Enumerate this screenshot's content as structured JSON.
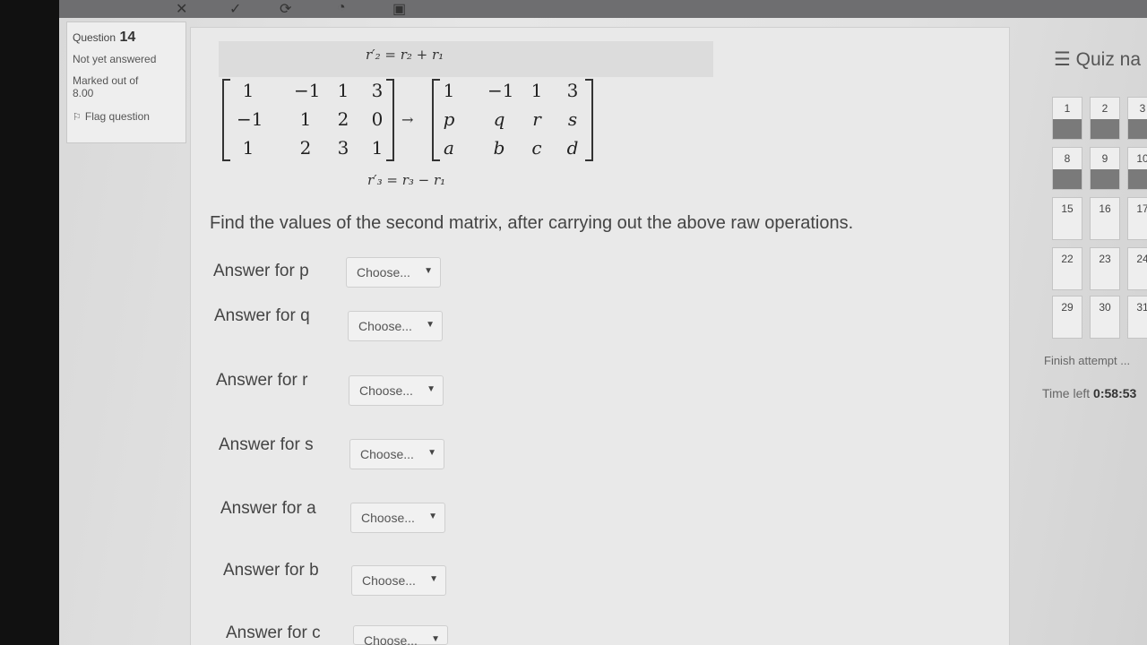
{
  "question_info": {
    "label": "Question",
    "number": "14",
    "status": "Not yet answered",
    "marked_line1": "Marked out of",
    "marked_line2": "8.00",
    "flag_label": "Flag question"
  },
  "problem": {
    "operation_top": "r′₂ = r₂ + r₁",
    "operation_bottom": "r′₃ = r₃ − r₁",
    "matrix_left": [
      [
        "1",
        "−1",
        "1",
        "3"
      ],
      [
        "−1",
        "1",
        "2",
        "0"
      ],
      [
        "1",
        "2",
        "3",
        "1"
      ]
    ],
    "matrix_right": [
      [
        "1",
        "−1",
        "1",
        "3"
      ],
      [
        "p",
        "q",
        "r",
        "s"
      ],
      [
        "a",
        "b",
        "c",
        "d"
      ]
    ],
    "arrow": "→",
    "question_text": "Find the values of the second matrix, after carrying out the above raw operations."
  },
  "answers": [
    {
      "label": "Answer for p",
      "value": "Choose..."
    },
    {
      "label": "Answer for q",
      "value": "Choose..."
    },
    {
      "label": "Answer for r",
      "value": "Choose..."
    },
    {
      "label": "Answer for s",
      "value": "Choose..."
    },
    {
      "label": "Answer for a",
      "value": "Choose..."
    },
    {
      "label": "Answer for b",
      "value": "Choose..."
    },
    {
      "label": "Answer for c",
      "value": "Choose..."
    }
  ],
  "quiz_nav": {
    "title": "Quiz na",
    "rows": [
      [
        "1",
        "2",
        "3"
      ],
      [
        "8",
        "9",
        "10"
      ],
      [
        "15",
        "16",
        "17"
      ],
      [
        "22",
        "23",
        "24"
      ],
      [
        "29",
        "30",
        "31"
      ]
    ],
    "finish_label": "Finish attempt ...",
    "time_left_label": "Time left",
    "time_left_value": "0:58:53"
  },
  "colors": {
    "answered_state": "#7a7a7a",
    "page_bg": "#e9e9e9"
  }
}
